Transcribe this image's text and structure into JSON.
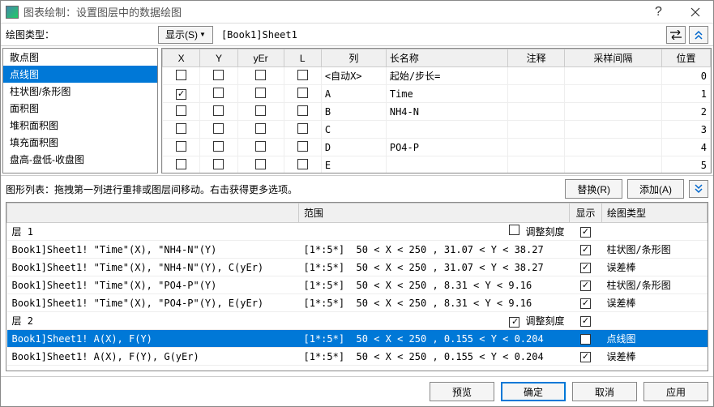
{
  "title": "图表绘制：设置图层中的数据绘图",
  "labels": {
    "plotTypeLabel": "绘图类型：",
    "showBtn": "显示(S)",
    "sheetName": "[Book1]Sheet1",
    "graphListLabel": "图形列表：拖拽第一列进行重排或图层间移动。右击获得更多选项。",
    "replaceBtn": "替换(R)",
    "addBtn": "添加(A)",
    "rescale": "调整刻度"
  },
  "plotTypes": [
    "散点图",
    "点线图",
    "柱状图/条形图",
    "面积图",
    "堆积面积图",
    "填充面积图",
    "盘高-盘低-收盘图"
  ],
  "plotTypeSelected": 1,
  "colHeaders": {
    "x": "X",
    "y": "Y",
    "yer": "yEr",
    "l": "L",
    "col": "列",
    "long": "长名称",
    "comment": "注释",
    "sample": "采样间隔",
    "pos": "位置"
  },
  "columns": [
    {
      "x": false,
      "y": false,
      "col": "<自动X>",
      "long": "起始/步长=",
      "pos": "0"
    },
    {
      "x": true,
      "y": false,
      "col": "A",
      "long": "Time",
      "pos": "1"
    },
    {
      "x": false,
      "y": false,
      "col": "B",
      "long": "NH4-N",
      "pos": "2"
    },
    {
      "x": false,
      "y": false,
      "col": "C",
      "long": "",
      "pos": "3"
    },
    {
      "x": false,
      "y": false,
      "col": "D",
      "long": "PO4-P",
      "pos": "4"
    },
    {
      "x": false,
      "y": false,
      "col": "E",
      "long": "",
      "pos": "5"
    }
  ],
  "listHeaders": {
    "range": "范围",
    "show": "显示",
    "type": "绘图类型"
  },
  "graphRows": [
    {
      "layer": "层 1",
      "rescale": false
    },
    {
      "desc": "Book1]Sheet1! \"Time\"(X), \"NH4-N\"(Y)",
      "range": "[1*:5*]",
      "bounds": "50 < X < 250 , 31.07 < Y < 38.27",
      "show": true,
      "type": "柱状图/条形图"
    },
    {
      "desc": "Book1]Sheet1! \"Time\"(X), \"NH4-N\"(Y), C(yEr)",
      "range": "[1*:5*]",
      "bounds": "50 < X < 250 , 31.07 < Y < 38.27",
      "show": true,
      "type": "误差棒"
    },
    {
      "desc": "Book1]Sheet1! \"Time\"(X), \"PO4-P\"(Y)",
      "range": "[1*:5*]",
      "bounds": "50 < X < 250 , 8.31 < Y < 9.16",
      "show": true,
      "type": "柱状图/条形图"
    },
    {
      "desc": "Book1]Sheet1! \"Time\"(X), \"PO4-P\"(Y), E(yEr)",
      "range": "[1*:5*]",
      "bounds": "50 < X < 250 , 8.31 < Y < 9.16",
      "show": true,
      "type": "误差棒"
    },
    {
      "layer": "层 2",
      "rescale": true
    },
    {
      "desc": "Book1]Sheet1! A(X), F(Y)",
      "range": "[1*:5*]",
      "bounds": "50 < X < 250 , 0.155 < Y < 0.204",
      "show": true,
      "type": "点线图",
      "sel": true
    },
    {
      "desc": "Book1]Sheet1! A(X), F(Y), G(yEr)",
      "range": "[1*:5*]",
      "bounds": "50 < X < 250 , 0.155 < Y < 0.204",
      "show": true,
      "type": "误差棒"
    }
  ],
  "footer": {
    "preview": "预览",
    "ok": "确定",
    "cancel": "取消",
    "apply": "应用"
  }
}
